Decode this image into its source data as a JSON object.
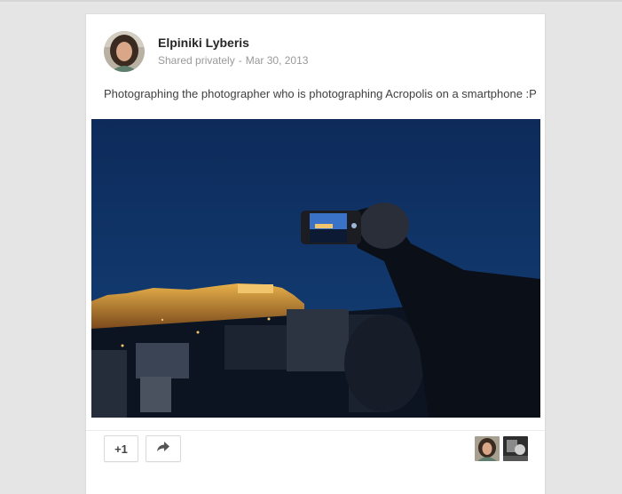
{
  "post": {
    "author": "Elpiniki Lyberis",
    "visibility": "Shared privately",
    "separator": "-",
    "date": "Mar 30, 2013",
    "text": "Photographing the photographer who is photographing Acropolis on a smartphone :P"
  },
  "actions": {
    "plus_one_label": "+1",
    "share_icon": "share-arrow-icon"
  },
  "colors": {
    "page_background": "#e5e5e5",
    "card_background": "#ffffff",
    "night_sky": "#0c2a55",
    "city_lights": "#e0a23a"
  }
}
